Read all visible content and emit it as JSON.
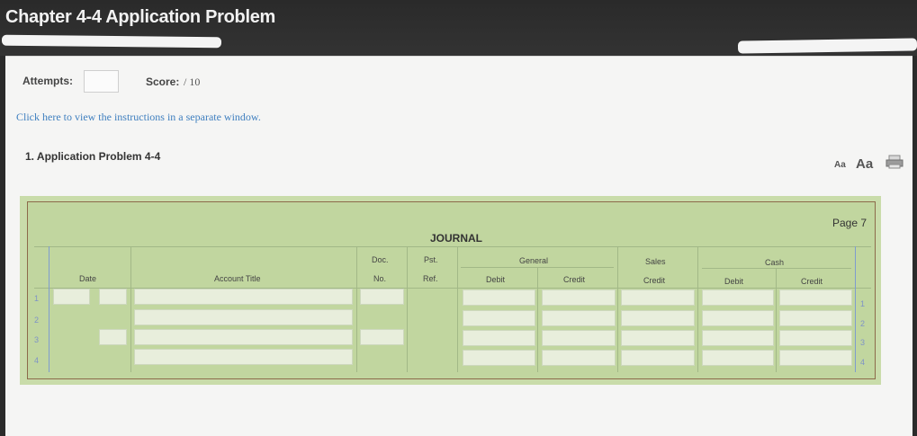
{
  "header": {
    "title": "Chapter 4-4 Application Problem"
  },
  "status": {
    "attempts_label": "Attempts:",
    "attempts_value": "",
    "score_label": "Score:",
    "score_value": "/ 10"
  },
  "links": {
    "instructions": "Click here to view the instructions in a separate window."
  },
  "problem": {
    "title": "1. Application Problem 4-4"
  },
  "tools": {
    "font_small": "Aa",
    "font_large": "Aa",
    "print_icon": "printer-icon"
  },
  "journal": {
    "title": "JOURNAL",
    "page": "Page 7",
    "columns": {
      "date": "Date",
      "account_title": "Account Title",
      "doc_top": "Doc.",
      "doc_bottom": "No.",
      "post_top": "Pst.",
      "post_bottom": "Ref.",
      "general": "General",
      "general_debit": "Debit",
      "general_credit": "Credit",
      "sales_top": "Sales",
      "sales_bottom": "Credit",
      "cash": "Cash",
      "cash_debit": "Debit",
      "cash_credit": "Credit"
    },
    "row_numbers": [
      "1",
      "2",
      "3",
      "4"
    ]
  }
}
